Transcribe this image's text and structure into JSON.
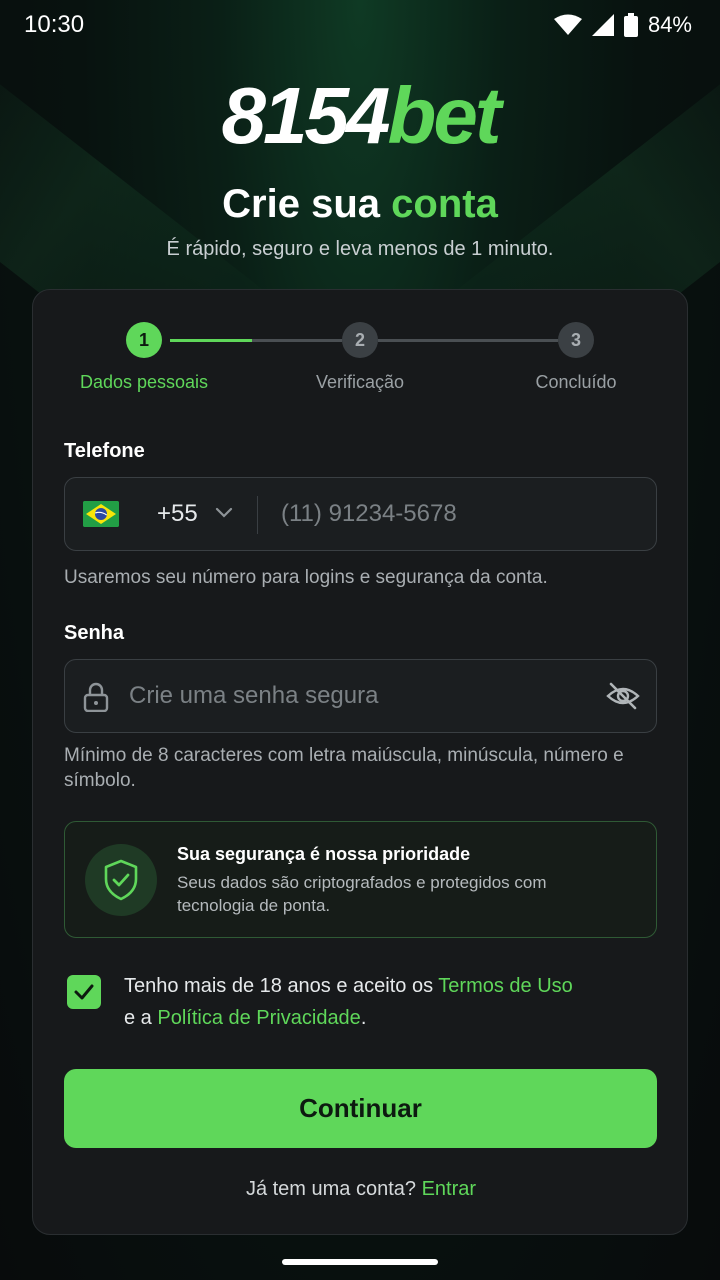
{
  "status_bar": {
    "time": "10:30",
    "battery": "84%",
    "icons": [
      "wifi-icon",
      "signal-icon",
      "battery-icon"
    ]
  },
  "header": {
    "logo_number": "8154",
    "logo_suffix": "bet",
    "title_main": "Crie sua",
    "title_accent": "conta",
    "subtitle": "É rápido, seguro e leva menos de 1 minuto."
  },
  "stepper": {
    "current_step": 1,
    "steps": [
      {
        "number": "1",
        "label": "Dados pessoais"
      },
      {
        "number": "2",
        "label": "Verificação"
      },
      {
        "number": "3",
        "label": "Concluído"
      }
    ]
  },
  "phone": {
    "label": "Telefone",
    "country_flag": "brazil-flag",
    "dial_code": "+55",
    "placeholder": "(11) 91234-5678",
    "value": "",
    "helper": "Usaremos seu número para logins e segurança da conta."
  },
  "password": {
    "label": "Senha",
    "placeholder": "Crie uma senha segura",
    "value": "",
    "helper": "Mínimo de 8 caracteres com letra maiúscula, minúscula, número e símbolo."
  },
  "security_notice": {
    "title": "Sua segurança é nossa prioridade",
    "description": "Seus dados são criptografados e protegidos com tecnologia de ponta."
  },
  "terms": {
    "checked": true,
    "text_1": "Tenho mais de 18 anos e aceito os ",
    "terms_link": "Termos de Uso",
    "text_2": "e a ",
    "privacy_link": "Política de Privacidade",
    "text_3": "."
  },
  "cta": {
    "label": "Continuar"
  },
  "login_prompt": {
    "text": "Já tem uma conta? ",
    "link": "Entrar"
  },
  "colors": {
    "accent": "#5fd75a",
    "card_bg": "#17191b",
    "page_bg": "#080b0c"
  }
}
